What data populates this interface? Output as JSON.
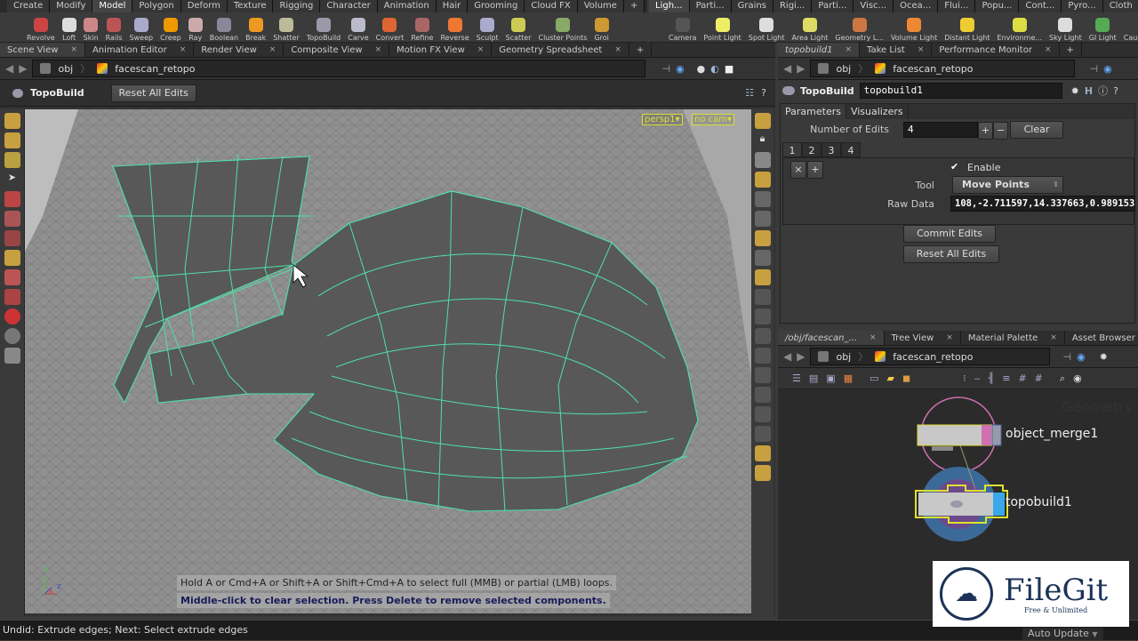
{
  "shelf_left": {
    "tabs": [
      "Create",
      "Modify",
      "Model",
      "Polygon",
      "Deform",
      "Texture",
      "Rigging",
      "Character",
      "Animation",
      "Hair",
      "Grooming",
      "Cloud FX",
      "Volume",
      "+"
    ],
    "active_tab": "Model",
    "tools": [
      "Revolve",
      "Loft",
      "Skin",
      "Rails",
      "Sweep",
      "Creep",
      "Ray",
      "Boolean",
      "Break",
      "Shatter",
      "TopoBuild",
      "Carve",
      "Convert",
      "Refine",
      "Reverse",
      "Sculpt",
      "Scatter",
      "Cluster Points",
      "Groi"
    ]
  },
  "shelf_right": {
    "tabs": [
      "Ligh...",
      "Parti...",
      "Grains",
      "Rigi...",
      "Parti...",
      "Visc...",
      "Ocea...",
      "Flui...",
      "Popu...",
      "Cont...",
      "Pyro...",
      "Cloth",
      "+"
    ],
    "tools": [
      "Camera",
      "Point Light",
      "Spot Light",
      "Area Light",
      "Geometry L...",
      "Volume Light",
      "Distant Light",
      "Environme...",
      "Sky Light",
      "GI Light",
      "Caustic Ligh"
    ]
  },
  "left_pane": {
    "tabs": [
      "Scene View",
      "Animation Editor",
      "Render View",
      "Composite View",
      "Motion FX View",
      "Geometry Spreadsheet"
    ],
    "path": {
      "root": "obj",
      "object": "facescan_retopo"
    },
    "operation": {
      "name": "TopoBuild",
      "reset_button": "Reset All Edits"
    },
    "viewport": {
      "camera_menu": "persp1▾",
      "cam_menu": "no cam▾",
      "hint1": "Hold A or Cmd+A or Shift+A or Shift+Cmd+A to select full (MMB) or partial (LMB) loops.",
      "hint2": "Middle-click to clear selection.  Press Delete to remove selected components.",
      "axis_y": "y",
      "axis_x": "x",
      "axis_z": "z"
    }
  },
  "params_pane": {
    "tabs": [
      "topobuild1",
      "Take List",
      "Performance Monitor"
    ],
    "path": {
      "root": "obj",
      "object": "facescan_retopo"
    },
    "node_type": "TopoBuild",
    "node_name": "topobuild1",
    "subtabs": [
      "Parameters",
      "Visualizers"
    ],
    "number_of_edits_label": "Number of Edits",
    "number_of_edits": "4",
    "plus": "+",
    "minus": "−",
    "clear": "Clear",
    "edit_tabs": [
      "1",
      "2",
      "3",
      "4"
    ],
    "remove": "×",
    "add": "+",
    "enable_label": "Enable",
    "enable_checked": true,
    "tool_label": "Tool",
    "tool_value": "Move Points",
    "raw_data_label": "Raw Data",
    "raw_data": "108,-2.711597,14.337663,0.989153",
    "commit": "Commit Edits",
    "reset": "Reset All Edits"
  },
  "network_pane": {
    "tabs": [
      "/obj/facescan_...",
      "Tree View",
      "Material Palette",
      "Asset Browser"
    ],
    "path": {
      "root": "obj",
      "object": "facescan_retopo"
    },
    "watermark": "Geometry",
    "nodes": [
      {
        "name": "object_merge1"
      },
      {
        "name": "topobuild1"
      }
    ],
    "auto_update": "Auto Update"
  },
  "status_bar": {
    "message": "Undid: Extrude edges; Next: Select extrude edges"
  },
  "logo": {
    "text": "FileGit",
    "tagline": "Free & Unlimited"
  },
  "colors": {
    "selection_edges": "#3fd0a0",
    "node_selected": "#e0e030",
    "display_flag": "#3aa8e8",
    "template_flag": "#d070b0"
  }
}
